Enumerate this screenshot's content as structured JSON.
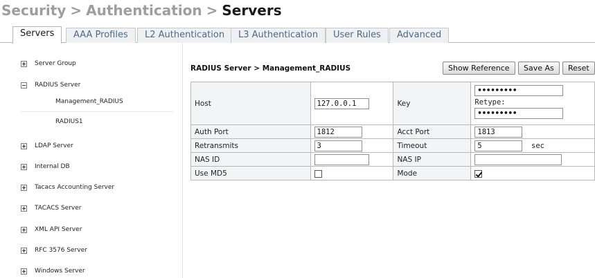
{
  "breadcrumb": {
    "part1": "Security",
    "sep1": ">",
    "part2": "Authentication",
    "sep2": ">",
    "current": "Servers"
  },
  "tabs": [
    {
      "label": "Servers",
      "active": true
    },
    {
      "label": "AAA Profiles"
    },
    {
      "label": "L2 Authentication"
    },
    {
      "label": "L3 Authentication"
    },
    {
      "label": "User Rules"
    },
    {
      "label": "Advanced"
    }
  ],
  "sidebar": {
    "items": [
      {
        "label": "Server Group",
        "expanded": false
      },
      {
        "label": "RADIUS Server",
        "expanded": true,
        "children": [
          "Management_RADIUS",
          "RADIUS1"
        ]
      },
      {
        "label": "LDAP Server",
        "expanded": false
      },
      {
        "label": "Internal DB",
        "expanded": false
      },
      {
        "label": "Tacacs Accounting Server",
        "expanded": false
      },
      {
        "label": "TACACS Server",
        "expanded": false
      },
      {
        "label": "XML API Server",
        "expanded": false
      },
      {
        "label": "RFC 3576 Server",
        "expanded": false
      },
      {
        "label": "Windows Server",
        "expanded": false
      }
    ]
  },
  "panel": {
    "title": "RADIUS Server > Management_RADIUS",
    "buttons": {
      "show_reference": "Show Reference",
      "save_as": "Save As",
      "reset": "Reset"
    }
  },
  "form": {
    "host": {
      "label": "Host",
      "value": "127.0.0.1"
    },
    "key": {
      "label": "Key",
      "value": "•••••••••",
      "retype_label": "Retype:",
      "retype_value": "•••••••••"
    },
    "auth_port": {
      "label": "Auth Port",
      "value": "1812"
    },
    "acct_port": {
      "label": "Acct Port",
      "value": "1813"
    },
    "retransmits": {
      "label": "Retransmits",
      "value": "3"
    },
    "timeout": {
      "label": "Timeout",
      "value": "5",
      "unit": "sec"
    },
    "nas_id": {
      "label": "NAS ID",
      "value": ""
    },
    "nas_ip": {
      "label": "NAS IP",
      "value": ""
    },
    "use_md5": {
      "label": "Use MD5",
      "checked": false
    },
    "mode": {
      "label": "Mode",
      "checked": true
    }
  }
}
